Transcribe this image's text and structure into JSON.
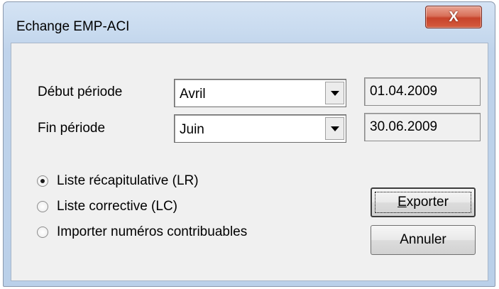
{
  "window": {
    "title": "Echange EMP-ACI",
    "close_glyph": "X"
  },
  "period": {
    "start_label": "Début période",
    "start_month": "Avril",
    "start_date": "01.04.2009",
    "end_label": "Fin période",
    "end_month": "Juin",
    "end_date": "30.06.2009"
  },
  "options": [
    {
      "label": "Liste récapitulative (LR)",
      "checked": true
    },
    {
      "label": "Liste corrective (LC)",
      "checked": false
    },
    {
      "label": "Importer numéros contribuables",
      "checked": false
    }
  ],
  "buttons": {
    "export_mnemonic": "E",
    "export_rest": "xporter",
    "cancel": "Annuler"
  },
  "colors": {
    "accent_close": "#c7432b",
    "client_bg": "#f0f0f0",
    "frame": "#bfd3eb"
  },
  "icons": {
    "close": "close-icon",
    "dropdown": "chevron-down-icon"
  }
}
